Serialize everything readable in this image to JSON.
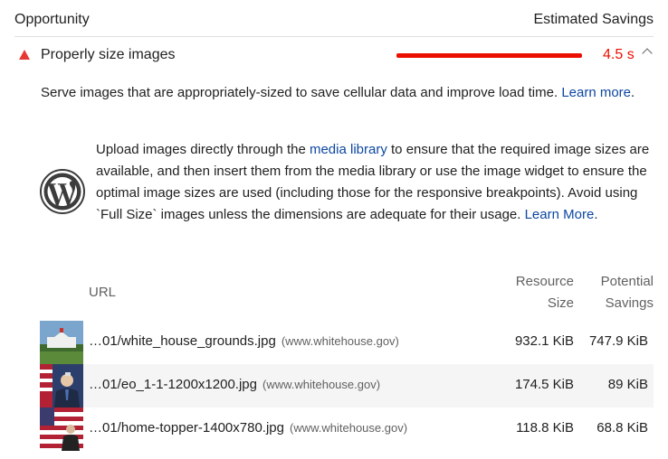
{
  "header": {
    "opportunity_label": "Opportunity",
    "savings_label": "Estimated Savings"
  },
  "audit": {
    "title": "Properly size images",
    "savings": "4.5 s",
    "status_color": "#eb0f00",
    "description": "Serve images that are appropriately-sized to save cellular data and improve load time.",
    "learn_more": "Learn more",
    "learn_more_punct": "."
  },
  "stack_pack": {
    "icon": "wordpress-logo",
    "text_1": "Upload images directly through the",
    "media_link": "media library",
    "text_2": "to ensure that the required image sizes are available, and then insert them from the media library or use the image widget to ensure the optimal image sizes are used (including those for the responsive breakpoints). Avoid using `Full Size` images unless the dimensions are adequate for their usage.",
    "learn_more": "Learn More",
    "learn_more_punct": "."
  },
  "table": {
    "columns": {
      "url": "URL",
      "resource_size": [
        "Resource",
        "Size"
      ],
      "potential_savings": [
        "Potential",
        "Savings"
      ]
    },
    "rows": [
      {
        "url": "…01/white_house_grounds.jpg",
        "host": "(www.whitehouse.gov)",
        "size": "932.1 KiB",
        "savings": "747.9 KiB",
        "thumb": "white-house-photo"
      },
      {
        "url": "…01/eo_1-1-1200x1200.jpg",
        "host": "(www.whitehouse.gov)",
        "size": "174.5 KiB",
        "savings": "89 KiB",
        "thumb": "president-photo"
      },
      {
        "url": "…01/home-topper-1400x780.jpg",
        "host": "(www.whitehouse.gov)",
        "size": "118.8 KiB",
        "savings": "68.8 KiB",
        "thumb": "flag-photo"
      }
    ]
  }
}
